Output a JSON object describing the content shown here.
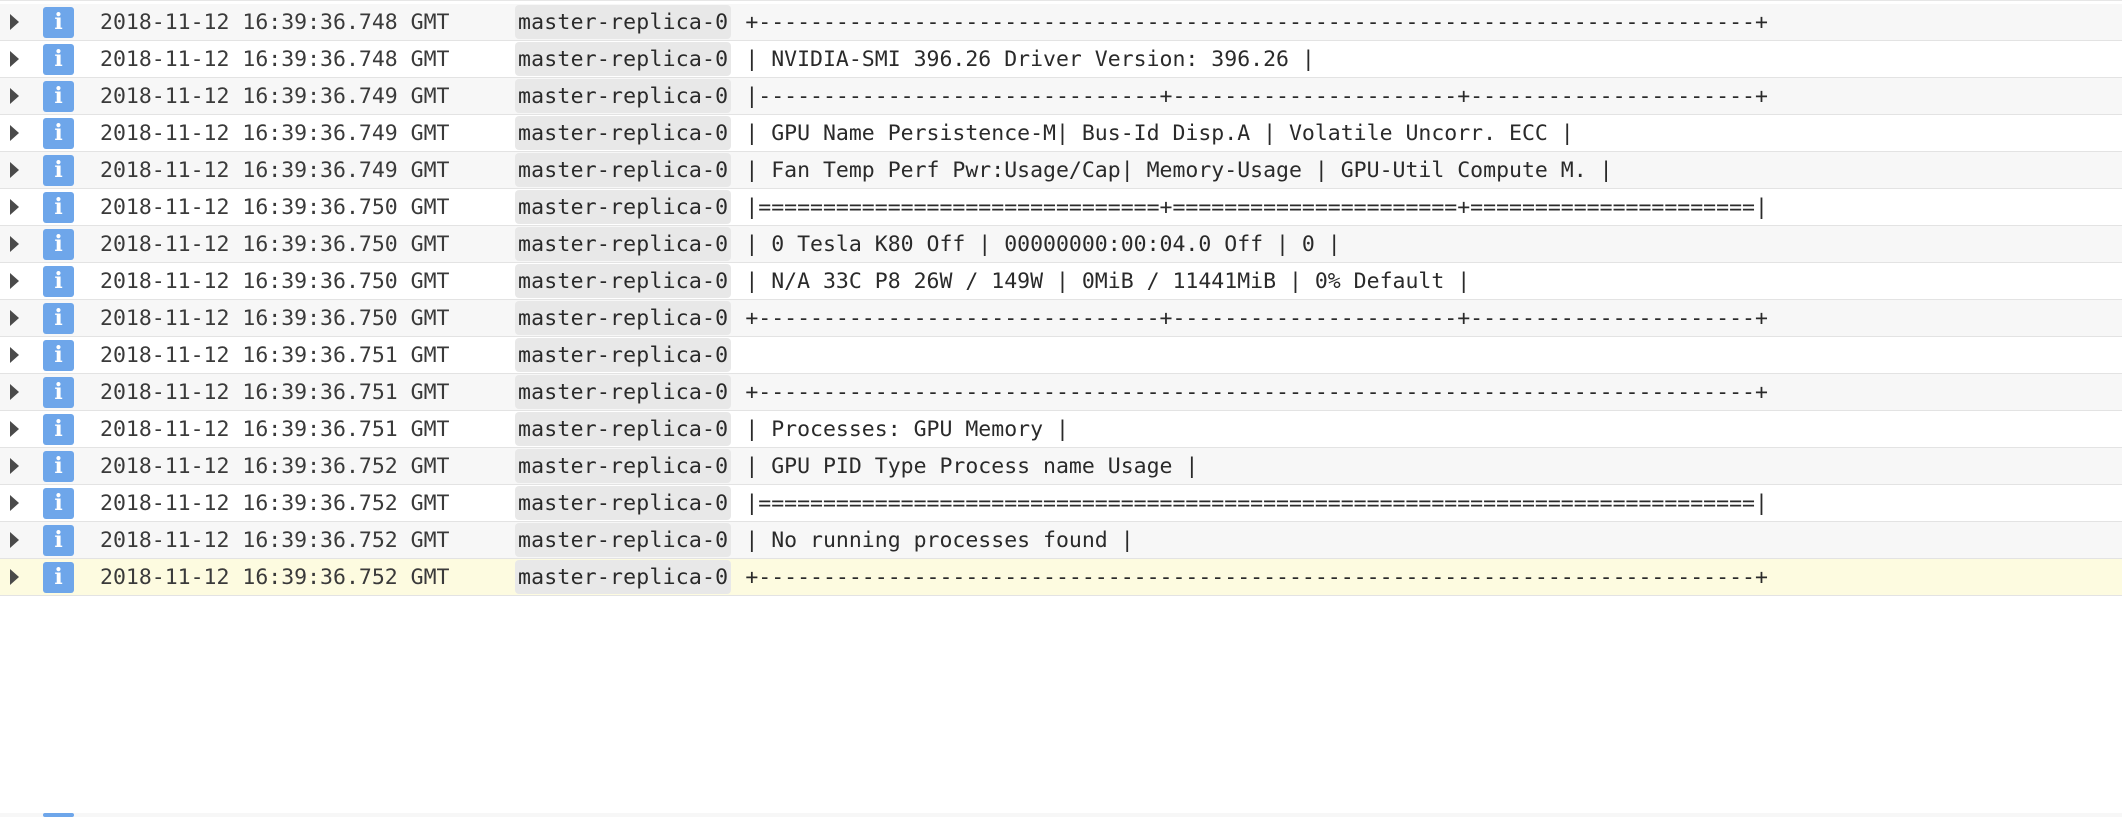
{
  "log": {
    "entries": [
      {
        "severity": "i",
        "timestamp": "2018-11-12 16:39:36.748 GMT",
        "source": "master-replica-0",
        "message": "+-----------------------------------------------------------------------------+"
      },
      {
        "severity": "i",
        "timestamp": "2018-11-12 16:39:36.748 GMT",
        "source": "master-replica-0",
        "message": "| NVIDIA-SMI 396.26 Driver Version: 396.26 |"
      },
      {
        "severity": "i",
        "timestamp": "2018-11-12 16:39:36.749 GMT",
        "source": "master-replica-0",
        "message": "|-------------------------------+----------------------+----------------------+"
      },
      {
        "severity": "i",
        "timestamp": "2018-11-12 16:39:36.749 GMT",
        "source": "master-replica-0",
        "message": "| GPU Name Persistence-M| Bus-Id Disp.A | Volatile Uncorr. ECC |"
      },
      {
        "severity": "i",
        "timestamp": "2018-11-12 16:39:36.749 GMT",
        "source": "master-replica-0",
        "message": "| Fan Temp Perf Pwr:Usage/Cap| Memory-Usage | GPU-Util Compute M. |"
      },
      {
        "severity": "i",
        "timestamp": "2018-11-12 16:39:36.750 GMT",
        "source": "master-replica-0",
        "message": "|===============================+======================+======================|"
      },
      {
        "severity": "i",
        "timestamp": "2018-11-12 16:39:36.750 GMT",
        "source": "master-replica-0",
        "message": "| 0 Tesla K80 Off | 00000000:00:04.0 Off | 0 |"
      },
      {
        "severity": "i",
        "timestamp": "2018-11-12 16:39:36.750 GMT",
        "source": "master-replica-0",
        "message": "| N/A 33C P8 26W / 149W | 0MiB / 11441MiB | 0% Default |"
      },
      {
        "severity": "i",
        "timestamp": "2018-11-12 16:39:36.750 GMT",
        "source": "master-replica-0",
        "message": "+-------------------------------+----------------------+----------------------+"
      },
      {
        "severity": "i",
        "timestamp": "2018-11-12 16:39:36.751 GMT",
        "source": "master-replica-0",
        "message": ""
      },
      {
        "severity": "i",
        "timestamp": "2018-11-12 16:39:36.751 GMT",
        "source": "master-replica-0",
        "message": "+-----------------------------------------------------------------------------+"
      },
      {
        "severity": "i",
        "timestamp": "2018-11-12 16:39:36.751 GMT",
        "source": "master-replica-0",
        "message": "| Processes: GPU Memory |"
      },
      {
        "severity": "i",
        "timestamp": "2018-11-12 16:39:36.752 GMT",
        "source": "master-replica-0",
        "message": "| GPU PID Type Process name Usage |"
      },
      {
        "severity": "i",
        "timestamp": "2018-11-12 16:39:36.752 GMT",
        "source": "master-replica-0",
        "message": "|=============================================================================|"
      },
      {
        "severity": "i",
        "timestamp": "2018-11-12 16:39:36.752 GMT",
        "source": "master-replica-0",
        "message": "| No running processes found |"
      },
      {
        "severity": "i",
        "timestamp": "2018-11-12 16:39:36.752 GMT",
        "source": "master-replica-0",
        "message": "+-----------------------------------------------------------------------------+"
      }
    ],
    "highlighted_index": 15,
    "colors": {
      "severity_info": "#6ea6ea",
      "row_bg": "#f7f7f7",
      "row_alt_bg": "#ffffff",
      "highlight_bg": "#fdfbe0",
      "chip_bg": "#e8e8e8"
    },
    "icons": {
      "expander": "caret-right-icon",
      "severity": "info-icon"
    }
  }
}
